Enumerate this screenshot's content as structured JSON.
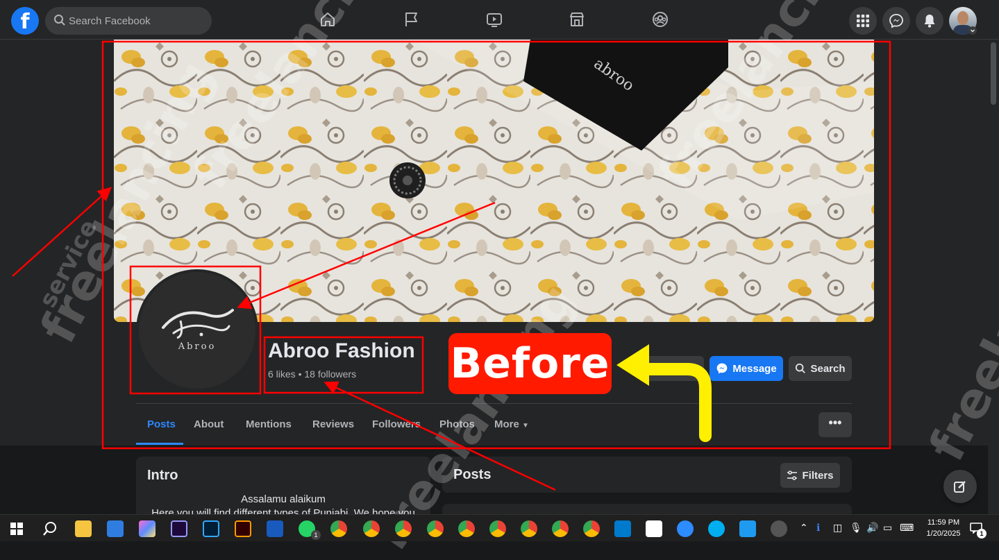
{
  "topbar": {
    "logo": "f",
    "search_placeholder": "Search Facebook",
    "nav": [
      "home-icon",
      "flag-icon",
      "video-icon",
      "marketplace-icon",
      "groups-icon"
    ],
    "right": [
      "menu-grid-icon",
      "messenger-icon",
      "bell-icon",
      "account-avatar"
    ]
  },
  "page": {
    "name": "Abroo Fashion",
    "stats": "6 likes • 18 followers",
    "logo_text": "Abroo",
    "buttons": {
      "message": "Message",
      "search": "Search"
    },
    "tabs": [
      "Posts",
      "About",
      "Mentions",
      "Reviews",
      "Followers",
      "Photos",
      "More"
    ],
    "active_tab": "Posts",
    "more_dots": "•••"
  },
  "annotation": {
    "label": "Before",
    "label_color": "#ff1a00",
    "arrow_color": "#ffef00",
    "box_color": "#ff0000"
  },
  "intro": {
    "title": "Intro",
    "line1": "Assalamu alaikum",
    "line2": "Here you will find different types of Punjabi. We hope you"
  },
  "posts": {
    "title": "Posts",
    "filters": "Filters"
  },
  "watermarks": [
    "freelancing",
    "service",
    "freelancing service"
  ],
  "taskbar": {
    "time": "11:59 PM",
    "date": "1/20/2025",
    "whatsapp_badge": "1",
    "notification_badge": "1"
  },
  "colors": {
    "facebook_blue": "#1877f2",
    "tab_active": "#2d88ff",
    "surface": "#242526",
    "background": "#18191a"
  }
}
